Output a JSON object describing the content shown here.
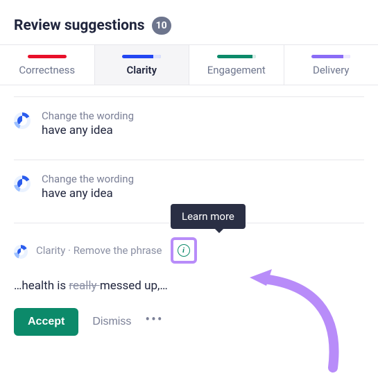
{
  "header": {
    "title": "Review suggestions",
    "count": "10"
  },
  "tabs": [
    {
      "label": "Correctness"
    },
    {
      "label": "Clarity"
    },
    {
      "label": "Engagement"
    },
    {
      "label": "Delivery"
    }
  ],
  "active_tab": "Clarity",
  "suggestions": [
    {
      "category": "Change the wording",
      "replacement": "have any idea"
    },
    {
      "category": "Change the wording",
      "replacement": "have any idea"
    }
  ],
  "expanded": {
    "category_label": "Clarity",
    "rule_label": "Remove the phrase",
    "separator": " · ",
    "tooltip": "Learn more",
    "sentence_prefix": "…health is ",
    "struck": "really ",
    "sentence_suffix": "messed up,…"
  },
  "actions": {
    "accept": "Accept",
    "dismiss": "Dismiss"
  },
  "colors": {
    "accent_purple": "#b88cf9",
    "accent_green": "#0c8a6a",
    "accent_blue": "#2346f2"
  }
}
